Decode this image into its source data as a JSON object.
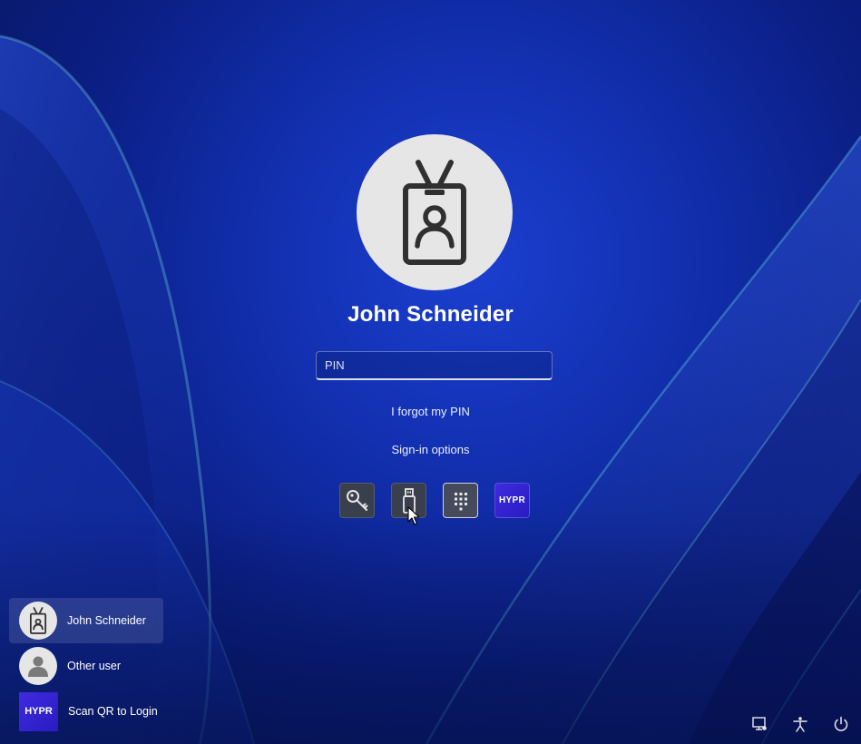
{
  "user": {
    "name": "John Schneider",
    "avatar_icon": "id-badge-icon"
  },
  "pin": {
    "placeholder": "PIN",
    "value": ""
  },
  "links": {
    "forgot_pin": "I forgot my PIN",
    "sign_in_options": "Sign-in options"
  },
  "sign_in_options": [
    {
      "icon": "key-icon",
      "label": "Password"
    },
    {
      "icon": "usb-key-icon",
      "label": "Security key",
      "selected": true
    },
    {
      "icon": "pin-pad-icon",
      "label": "PIN",
      "selected": true
    },
    {
      "icon": "hypr-logo",
      "label": "HYPR"
    }
  ],
  "hypr_logo_text": "HYPR",
  "user_list": [
    {
      "label": "John Schneider",
      "icon": "id-badge-icon",
      "active": true
    },
    {
      "label": "Other user",
      "icon": "generic-user-icon",
      "active": false
    },
    {
      "label": "Scan QR to Login",
      "icon": "hypr-logo",
      "active": false
    }
  ],
  "system_icons": [
    "network-icon",
    "accessibility-icon",
    "power-icon"
  ],
  "colors": {
    "background": "#0b1f86",
    "accent_hypr": "#3e2be0",
    "avatar_bg": "#e6e6e6"
  }
}
